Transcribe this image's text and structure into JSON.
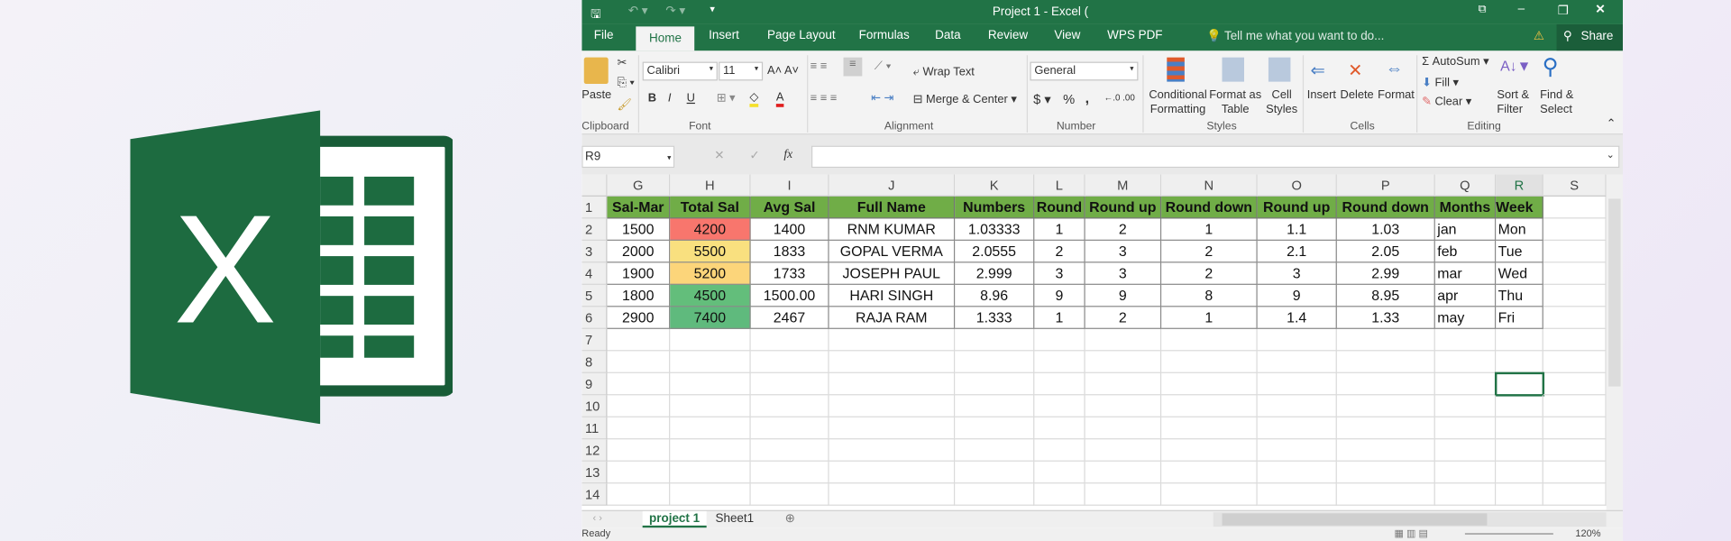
{
  "window": {
    "title": "Project 1 - Excel (",
    "accent": "#217346"
  },
  "tabs": [
    "File",
    "Home",
    "Insert",
    "Page Layout",
    "Formulas",
    "Data",
    "Review",
    "View",
    "WPS PDF"
  ],
  "tell_me": "Tell me what you want to do...",
  "share": "Share",
  "ribbon": {
    "clipboard": {
      "paste": "Paste",
      "label": "Clipboard"
    },
    "font": {
      "name": "Calibri",
      "size": "11",
      "bold": "B",
      "italic": "I",
      "underline": "U",
      "label": "Font"
    },
    "alignment": {
      "wrap": "Wrap Text",
      "merge": "Merge & Center",
      "label": "Alignment"
    },
    "number": {
      "format": "General",
      "currency": "$",
      "percent": "%",
      "comma": ",",
      "label": "Number"
    },
    "styles": {
      "conditional": "Conditional Formatting",
      "format_table": "Format as Table",
      "cell_styles": "Cell Styles",
      "label": "Styles"
    },
    "cells": {
      "insert": "Insert",
      "delete": "Delete",
      "format": "Format",
      "label": "Cells"
    },
    "editing": {
      "autosum": "AutoSum",
      "fill": "Fill",
      "clear": "Clear",
      "sort": "Sort & Filter",
      "find": "Find & Select",
      "label": "Editing"
    }
  },
  "formula_bar": {
    "name_box": "R9",
    "fx": "fx",
    "value": ""
  },
  "columns": [
    "G",
    "H",
    "I",
    "J",
    "K",
    "L",
    "M",
    "N",
    "O",
    "P",
    "Q",
    "R",
    "S"
  ],
  "rows": [
    "1",
    "2",
    "3",
    "4",
    "5",
    "6",
    "7",
    "8",
    "9",
    "10",
    "11",
    "12",
    "13",
    "14"
  ],
  "header_row": [
    "Sal-Mar",
    "Total Sal",
    "Avg Sal",
    "Full Name",
    "Numbers",
    "Round",
    "Round up",
    "Round down",
    "Round up",
    "Round down",
    "Months",
    "Week"
  ],
  "data_rows": [
    [
      "1500",
      "4200",
      "1400",
      "RNM  KUMAR",
      "1.03333",
      "1",
      "2",
      "1",
      "1.1",
      "1.03",
      "jan",
      "Mon"
    ],
    [
      "2000",
      "5500",
      "1833",
      "GOPAL  VERMA",
      "2.0555",
      "2",
      "3",
      "2",
      "2.1",
      "2.05",
      "feb",
      "Tue"
    ],
    [
      "1900",
      "5200",
      "1733",
      "JOSEPH  PAUL",
      "2.999",
      "3",
      "3",
      "2",
      "3",
      "2.99",
      "mar",
      "Wed"
    ],
    [
      "1800",
      "4500",
      "1500.00",
      "HARI  SINGH",
      "8.96",
      "9",
      "9",
      "8",
      "9",
      "8.95",
      "apr",
      "Thu"
    ],
    [
      "2900",
      "7400",
      "2467",
      "RAJA  RAM",
      "1.333",
      "1",
      "2",
      "1",
      "1.4",
      "1.33",
      "may",
      "Fri"
    ]
  ],
  "total_sal_colors": [
    "#f8766d",
    "#f9e07f",
    "#fcd57a",
    "#63be7b",
    "#5fba7d"
  ],
  "header_color": "#70ad47",
  "sheets": [
    "project 1",
    "Sheet1"
  ],
  "status": {
    "text": "Ready",
    "zoom": "120%"
  }
}
